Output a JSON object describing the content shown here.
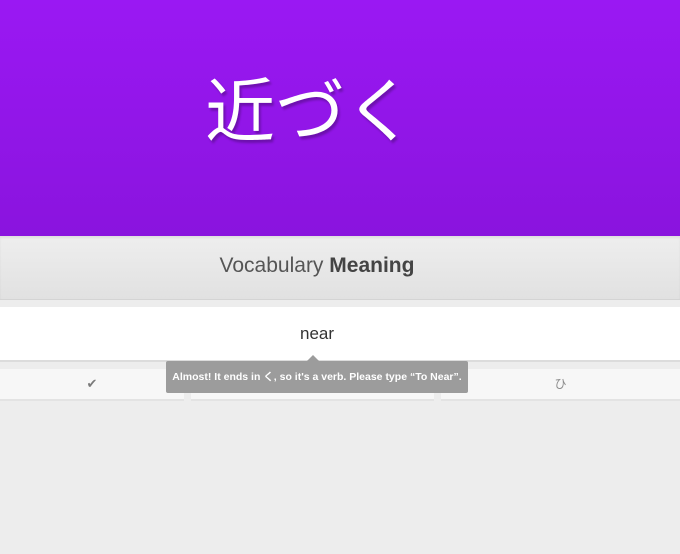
{
  "item": {
    "characters": "近づく"
  },
  "question": {
    "category": "Vocabulary",
    "type": "Meaning"
  },
  "answer": {
    "value": "near",
    "placeholder": ""
  },
  "buttons": {
    "submit_icon": "check-icon",
    "submit_glyph": "✔",
    "middle_label": "",
    "kana_label": "ひ"
  },
  "tooltip": {
    "message": "Almost! It ends in く, so it's a verb. Please type “To Near”."
  },
  "colors": {
    "header_purple": "#9a18f3",
    "tooltip_gray": "#9c9c9c",
    "background": "#ededed"
  }
}
